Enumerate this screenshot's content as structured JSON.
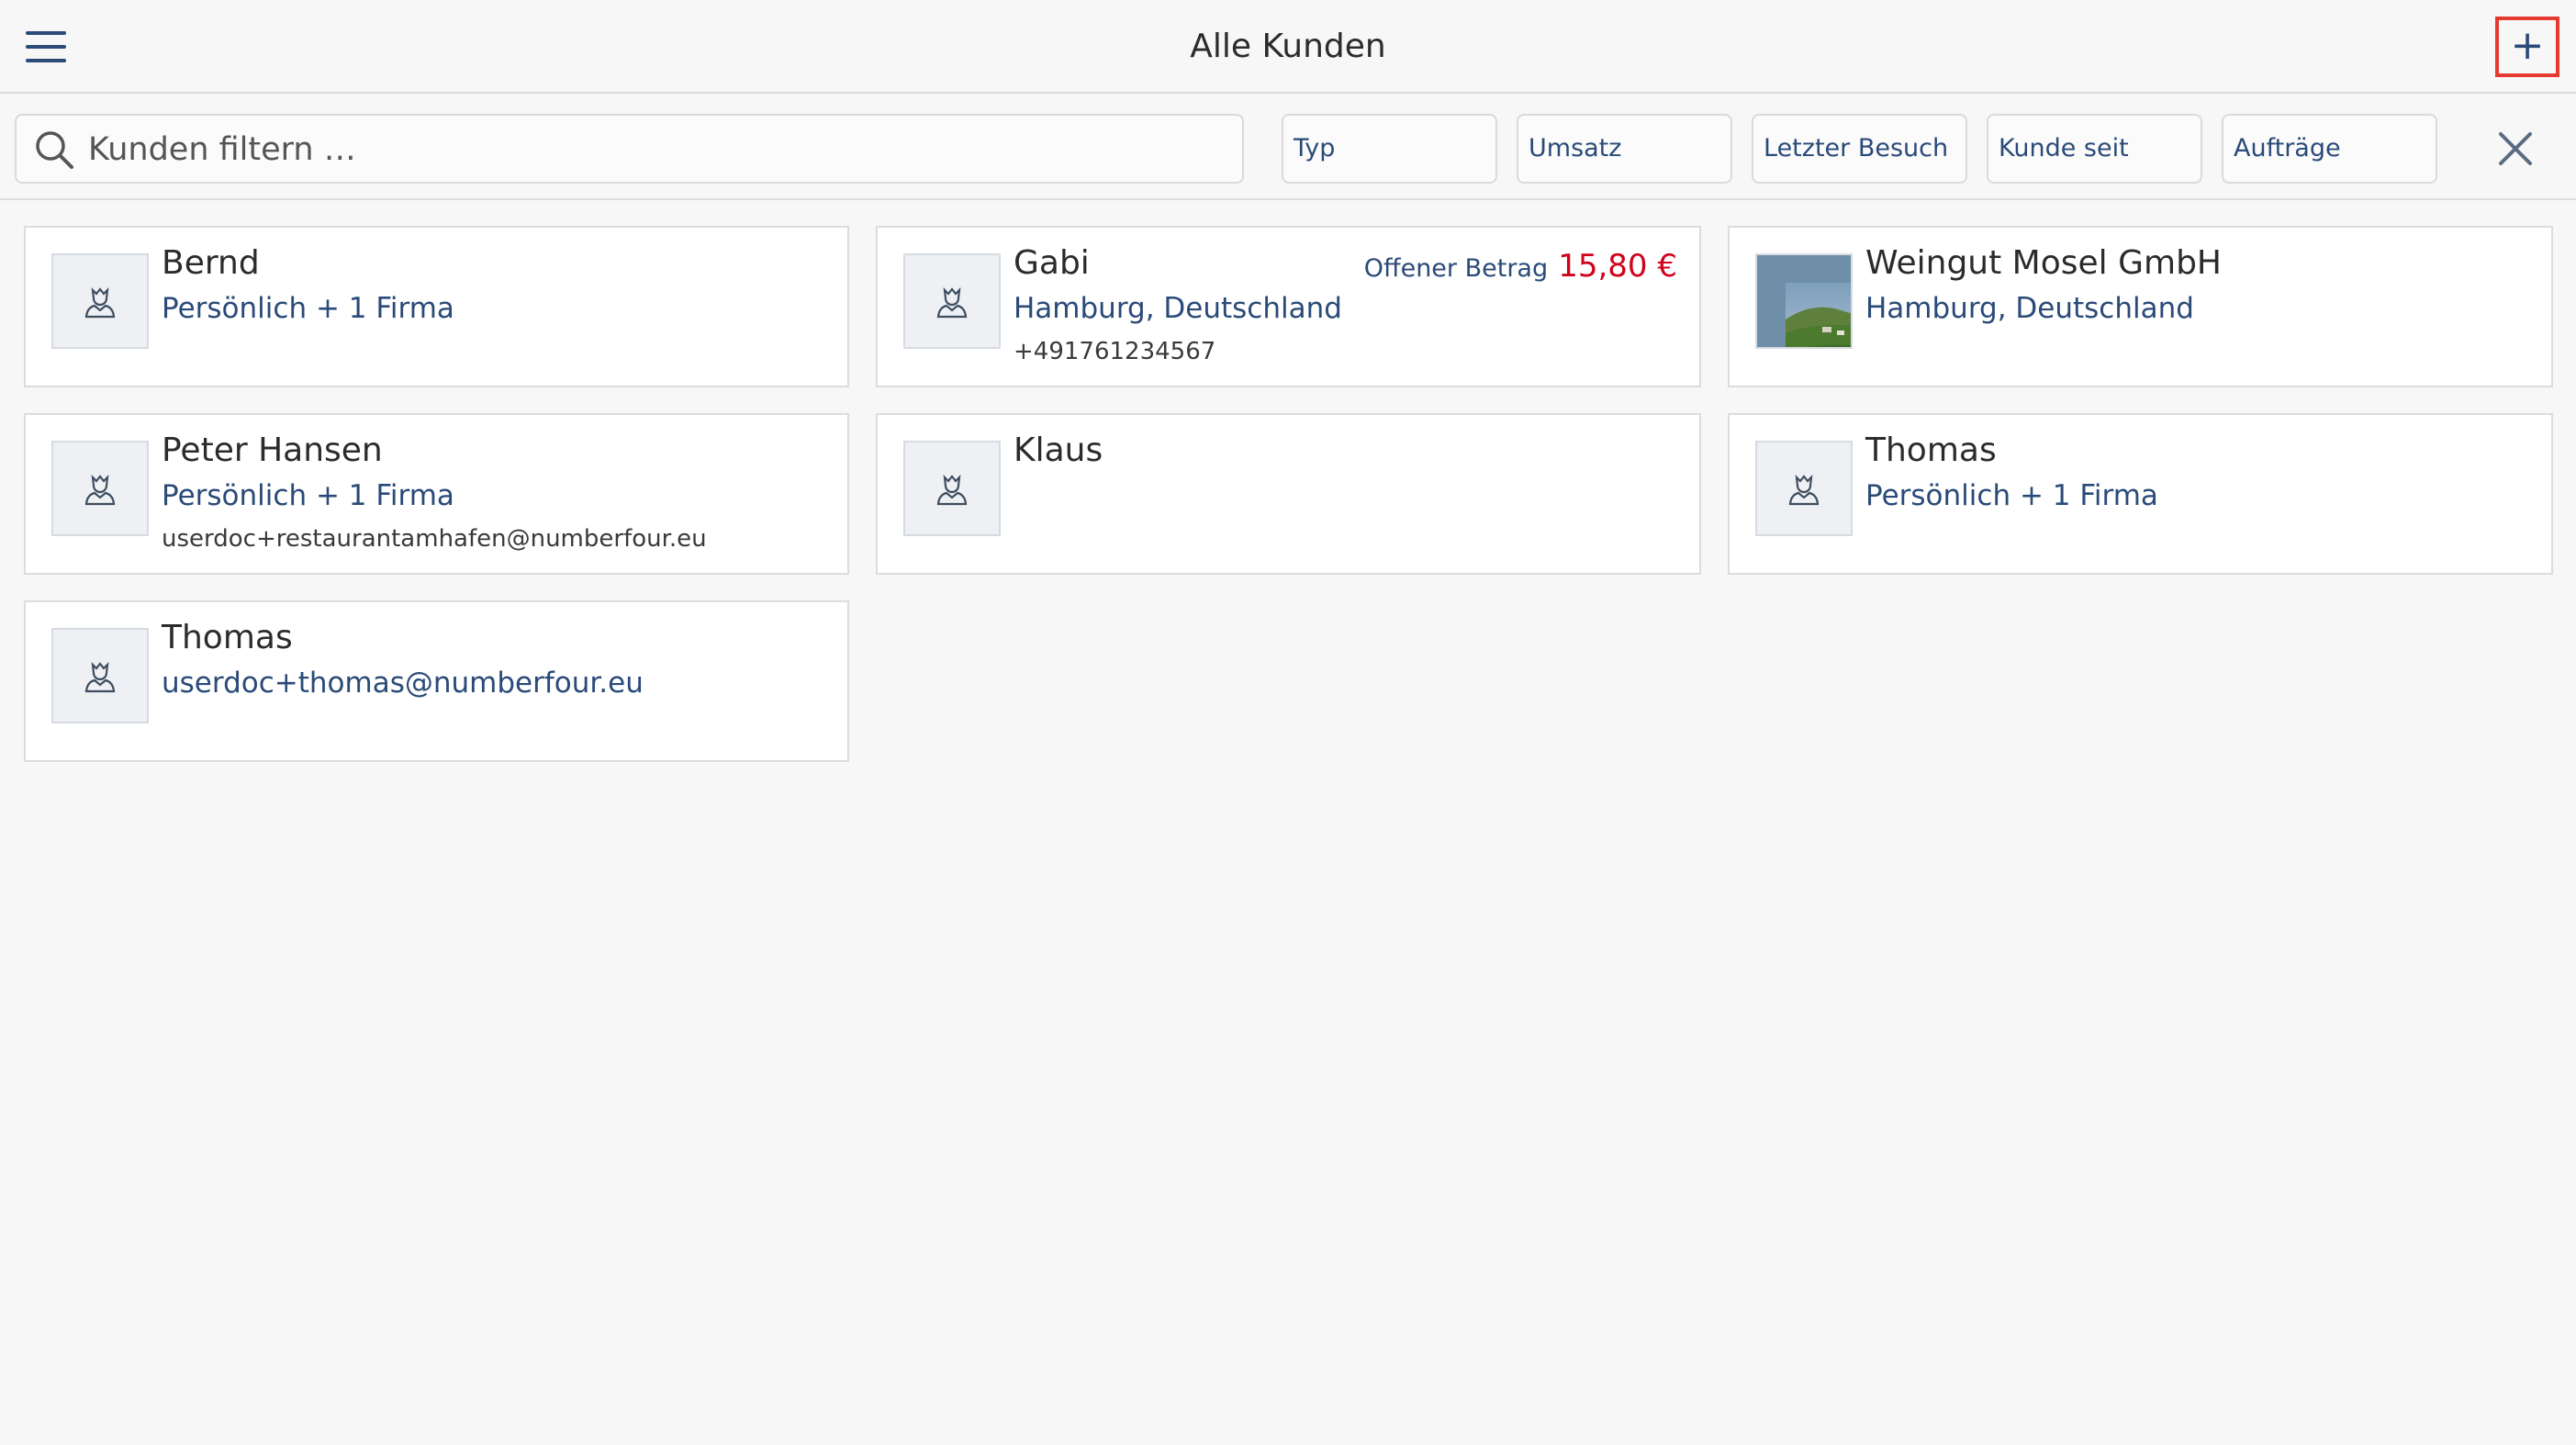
{
  "header": {
    "title": "Alle Kunden"
  },
  "filter": {
    "placeholder": "Kunden filtern …",
    "chips": [
      "Typ",
      "Umsatz",
      "Letzter Besuch",
      "Kunde seit",
      "Aufträge"
    ]
  },
  "customers": [
    {
      "name": "Bernd",
      "line1": "Persönlich + 1 Firma",
      "line2": ""
    },
    {
      "name": "Gabi",
      "line1": "Hamburg, Deutschland",
      "line2": "+491761234567",
      "open_label": "Offener Betrag",
      "open_amount": "15,80 €"
    },
    {
      "name": "Weingut Mosel GmbH",
      "line1": "Hamburg, Deutschland",
      "line2": ""
    },
    {
      "name": "Peter Hansen",
      "line1": "Persönlich + 1 Firma",
      "line2": "userdoc+restaurantamhafen@numberfour.eu"
    },
    {
      "name": "Klaus",
      "line1": "",
      "line2": ""
    },
    {
      "name": "Thomas",
      "line1": "Persönlich + 1 Firma",
      "line2": ""
    },
    {
      "name": "Thomas",
      "line1": "userdoc+thomas@numberfour.eu",
      "line2": ""
    }
  ],
  "icons": {
    "menu": "hamburger-menu-icon",
    "add": "plus-icon",
    "search": "search-icon",
    "clear": "close-icon",
    "avatar": "person-placeholder-icon",
    "photo": "vineyard-photo"
  },
  "colors": {
    "accent": "#2a4a78",
    "highlight": "#e53a2f",
    "amount": "#d0021b",
    "background": "#f7f7f7"
  }
}
